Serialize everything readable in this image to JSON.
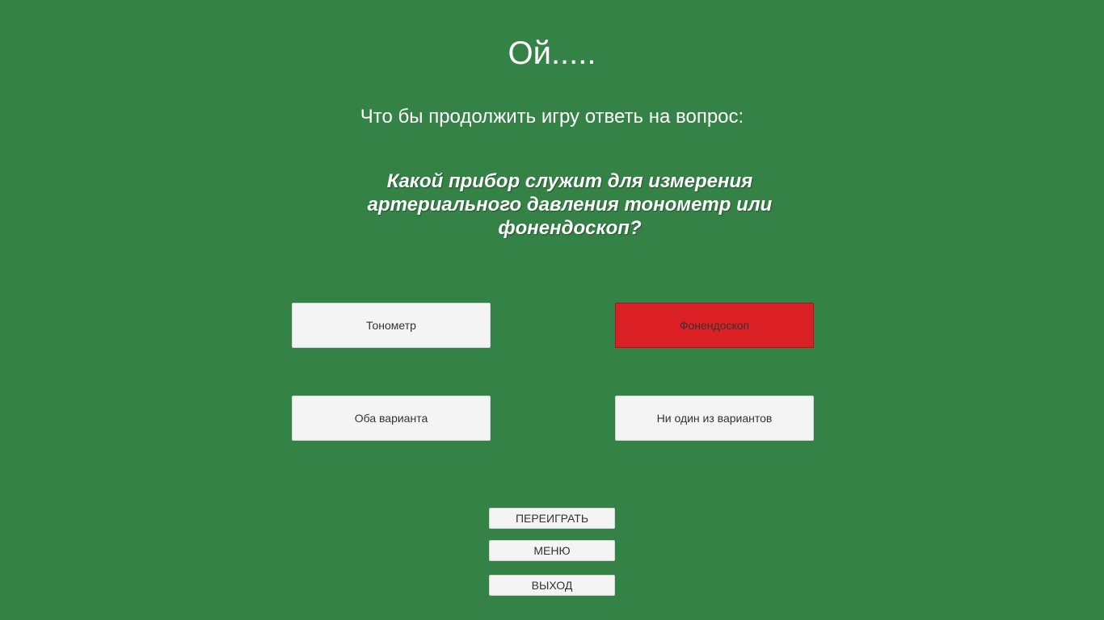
{
  "screen": {
    "title": "Ой.....",
    "prompt": "Что бы продолжить игру ответь на вопрос:",
    "question": "Какой прибор служит для измерения артериального давления тонометр или фонендоскоп?"
  },
  "answers": [
    {
      "label": "Тонометр",
      "state": "normal"
    },
    {
      "label": "Фонендоскоп",
      "state": "wrong"
    },
    {
      "label": "Оба варианта",
      "state": "normal"
    },
    {
      "label": "Ни один из вариантов",
      "state": "normal"
    }
  ],
  "menu": {
    "replay_label": "ПЕРЕИГРАТЬ",
    "menu_label": "МЕНЮ",
    "exit_label": "ВЫХОД"
  },
  "colors": {
    "background": "#348245",
    "button": "#f4f4f4",
    "wrong_answer": "#dc2126",
    "text": "#ffffff"
  }
}
